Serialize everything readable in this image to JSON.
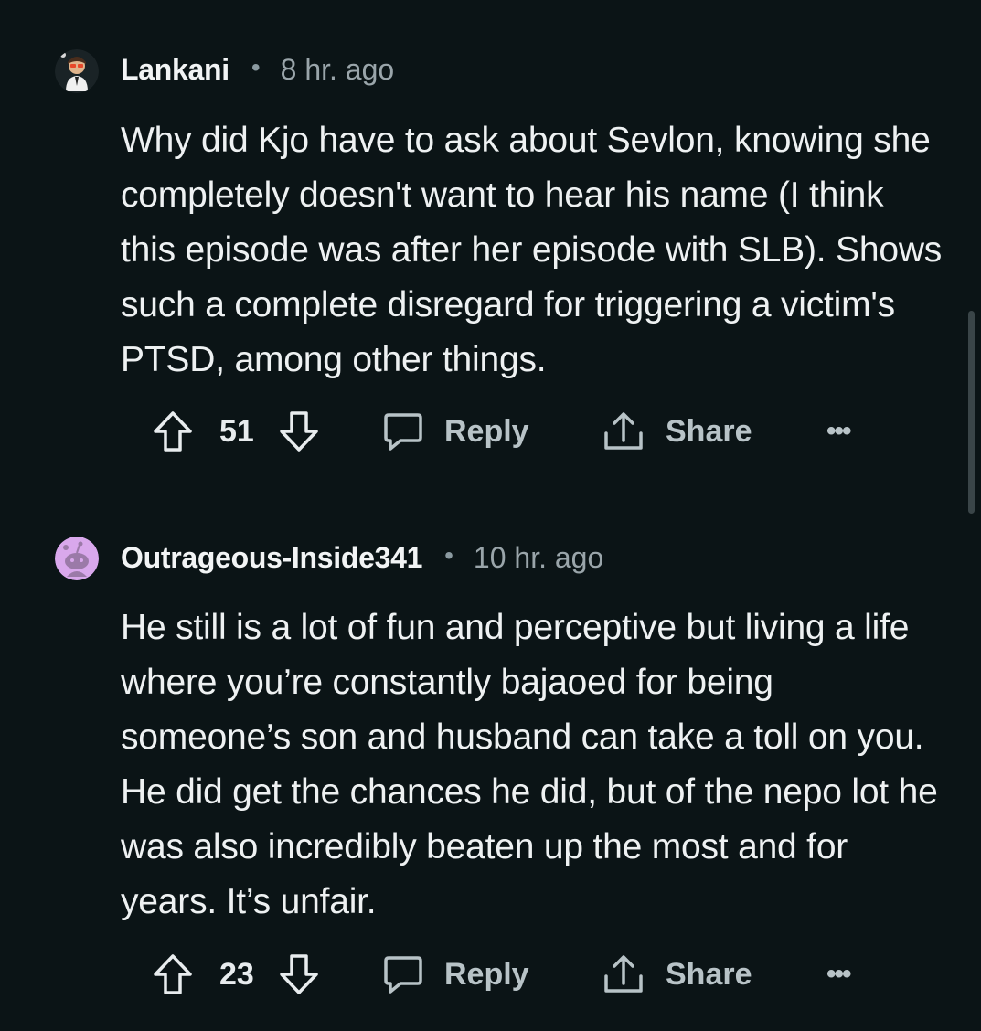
{
  "comments": [
    {
      "username": "Lankani",
      "separator": "•",
      "time": "8 hr. ago",
      "text": "Why did Kjo have to ask about Sevlon, knowing she completely doesn't want to hear his name (I think this episode was after her episode with SLB). Shows such a complete disregard for triggering a victim's PTSD, among other things.",
      "votes": "51",
      "reply_label": "Reply",
      "share_label": "Share",
      "more_label": "•••"
    },
    {
      "username": "Outrageous-Inside341",
      "separator": "•",
      "time": "10 hr. ago",
      "text": "He still is a lot of fun and perceptive but living a life where you’re constantly bajaoed for being someone’s son and husband can take a toll on you. He did get the chances he did, but of the nepo lot he was also incredibly beaten up the most and for years. It’s unfair.",
      "votes": "23",
      "reply_label": "Reply",
      "share_label": "Share",
      "more_label": "•••"
    }
  ],
  "icons": {
    "upvote": "arrow-up-outline-icon",
    "downvote": "arrow-down-outline-icon",
    "reply": "speech-bubble-icon",
    "share": "share-upload-icon",
    "more": "ellipsis-icon"
  },
  "colors": {
    "background": "#0b1416",
    "text": "#eef1f2",
    "muted": "#9aa5aa",
    "avatar2": "#d9a8ec"
  }
}
